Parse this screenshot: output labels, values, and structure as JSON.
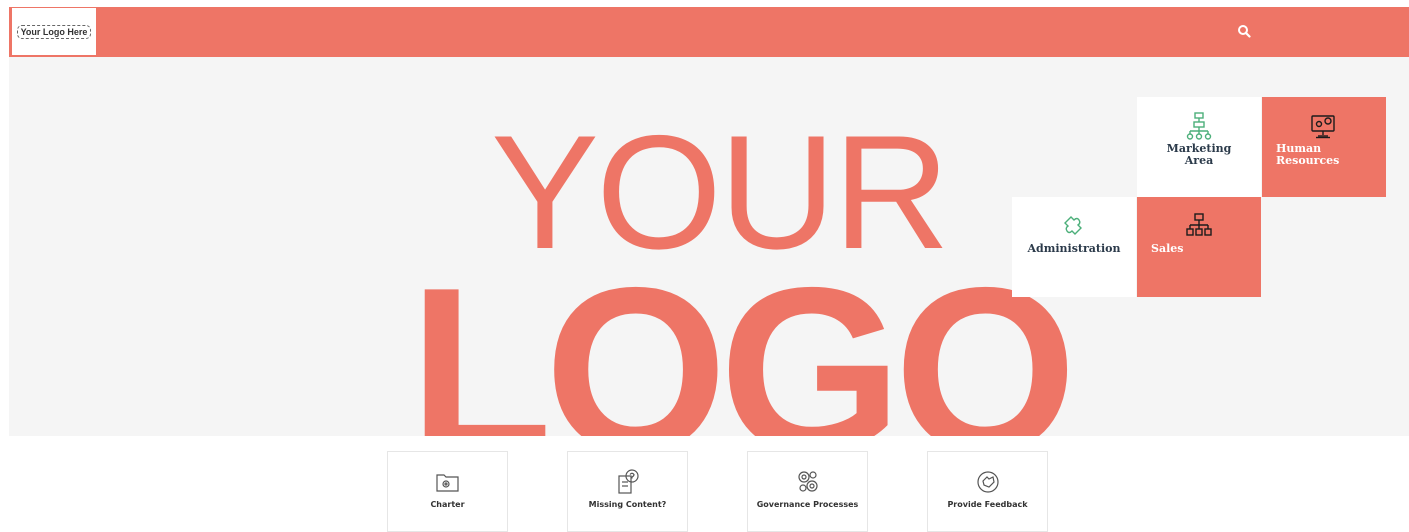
{
  "header": {
    "logo_text": "Your Logo Here",
    "search_icon": "search-icon",
    "bar_color": "#ee7566"
  },
  "hero": {
    "line1": "YOUR",
    "line2": "LOGO"
  },
  "tiles": [
    {
      "label": "Marketing Area",
      "icon": "flowchart-icon",
      "style": "white"
    },
    {
      "label": "Human Resources",
      "icon": "monitor-gear-icon",
      "style": "coral"
    },
    {
      "label": "Administration",
      "icon": "puzzle-icon",
      "style": "white"
    },
    {
      "label": "Sales",
      "icon": "org-chart-icon",
      "style": "coral"
    }
  ],
  "cards": [
    {
      "label": "Charter",
      "icon": "folder-gear-icon"
    },
    {
      "label": "Missing Content?",
      "icon": "question-document-icon"
    },
    {
      "label": "Governance Processes",
      "icon": "gears-icon"
    },
    {
      "label": "Provide Feedback",
      "icon": "feedback-hand-icon"
    }
  ]
}
